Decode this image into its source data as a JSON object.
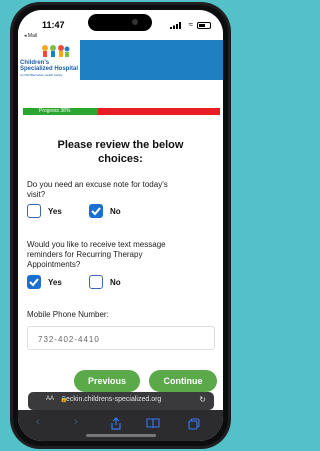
{
  "status_bar": {
    "time": "11:47",
    "back_label": "◂ Mail"
  },
  "header": {
    "logo_line1": "Children's",
    "logo_line2": "Specialized Hospital",
    "logo_sub": "An RWJBarnabas Health facility",
    "colors": {
      "header": "#1e7fc3"
    }
  },
  "progress": {
    "label": "Progress 38%",
    "value": 0.38,
    "colors": {
      "done": "#2ca530",
      "remaining": "#e81c23"
    }
  },
  "form": {
    "title_line1": "Please review the below",
    "title_line2": "choices:",
    "q1": {
      "text_line1": "Do you need an excuse note for today's",
      "text_line2": "visit?",
      "yes": "Yes",
      "no": "No",
      "selected": "No"
    },
    "q2": {
      "text_line1": "Would you like to receive text message",
      "text_line2": "reminders for Recurring Therapy",
      "text_line3": "Appointments?",
      "yes": "Yes",
      "no": "No",
      "selected": "Yes"
    },
    "phone_label": "Mobile Phone Number:",
    "phone_value": "732-402-4410",
    "previous": "Previous",
    "continue": "Continue"
  },
  "browser": {
    "aa": "AA",
    "url": "eckin.childrens-specialized.org",
    "reload_icon": "reload-icon"
  },
  "toolbar": {
    "icons": [
      "back-icon",
      "forward-icon",
      "share-icon",
      "bookmarks-icon",
      "tabs-icon"
    ]
  }
}
